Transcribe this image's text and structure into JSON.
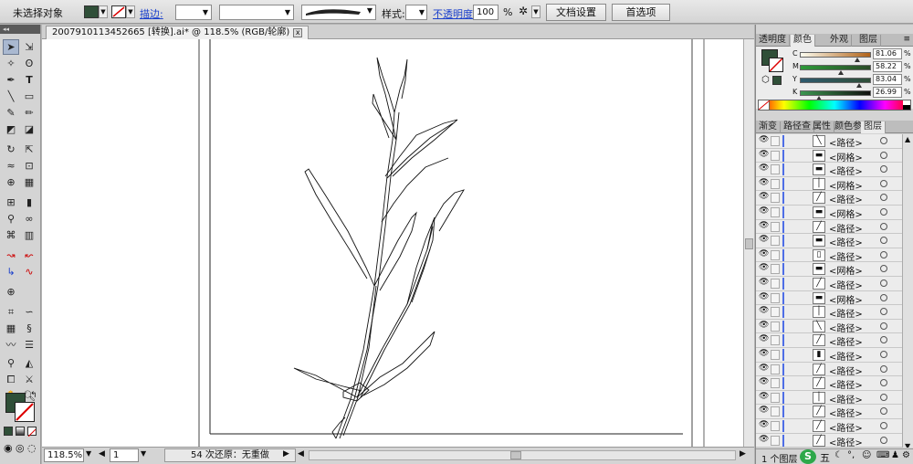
{
  "control_bar": {
    "selection_label": "未选择对象",
    "fill_color": "#2f4f38",
    "stroke_label": "描边:",
    "style_label": "样式:",
    "opacity_label": "不透明度:",
    "opacity_value": "100",
    "opacity_unit": "%",
    "doc_setup_button": "文档设置",
    "preferences_button": "首选项"
  },
  "document": {
    "tab_title": "2007910113452665 [转换].ai* @ 118.5% (RGB/轮廓)",
    "close_glyph": "x"
  },
  "status_bar": {
    "zoom": "118.5%",
    "artboard": "1",
    "history": "54 次还原：无重做"
  },
  "panels": {
    "top_tabs": [
      "透明度",
      "颜色",
      "外观",
      "图层"
    ],
    "color": {
      "fill_color": "#2f4f38",
      "sliders": [
        {
          "label": "C",
          "value": "81.06",
          "unit": "%",
          "level": 0.81,
          "from": "#fdfdf0",
          "to": "#b06218"
        },
        {
          "label": "M",
          "value": "58.22",
          "unit": "%",
          "level": 0.58,
          "from": "#2d9a3a",
          "to": "#2c4b28"
        },
        {
          "label": "Y",
          "value": "83.04",
          "unit": "%",
          "level": 0.83,
          "from": "#2e5a6e",
          "to": "#2f4f38"
        },
        {
          "label": "K",
          "value": "26.99",
          "unit": "%",
          "level": 0.27,
          "from": "#3d9650",
          "to": "#101010"
        }
      ]
    },
    "lower_tabs": [
      "渐变",
      "路径查",
      "属性",
      "颜色参",
      "图层"
    ],
    "layers": [
      "<路径>",
      "<网格>",
      "<路径>",
      "<网格>",
      "<路径>",
      "<网格>",
      "<路径>",
      "<路径>",
      "<路径>",
      "<网格>",
      "<路径>",
      "<网格>",
      "<路径>",
      "<路径>",
      "<路径>",
      "<路径>",
      "<路径>",
      "<路径>",
      "<路径>",
      "<路径>",
      "<路径>",
      "<路径>"
    ],
    "layers_footer": "1 个图层",
    "ime_label": "五"
  }
}
